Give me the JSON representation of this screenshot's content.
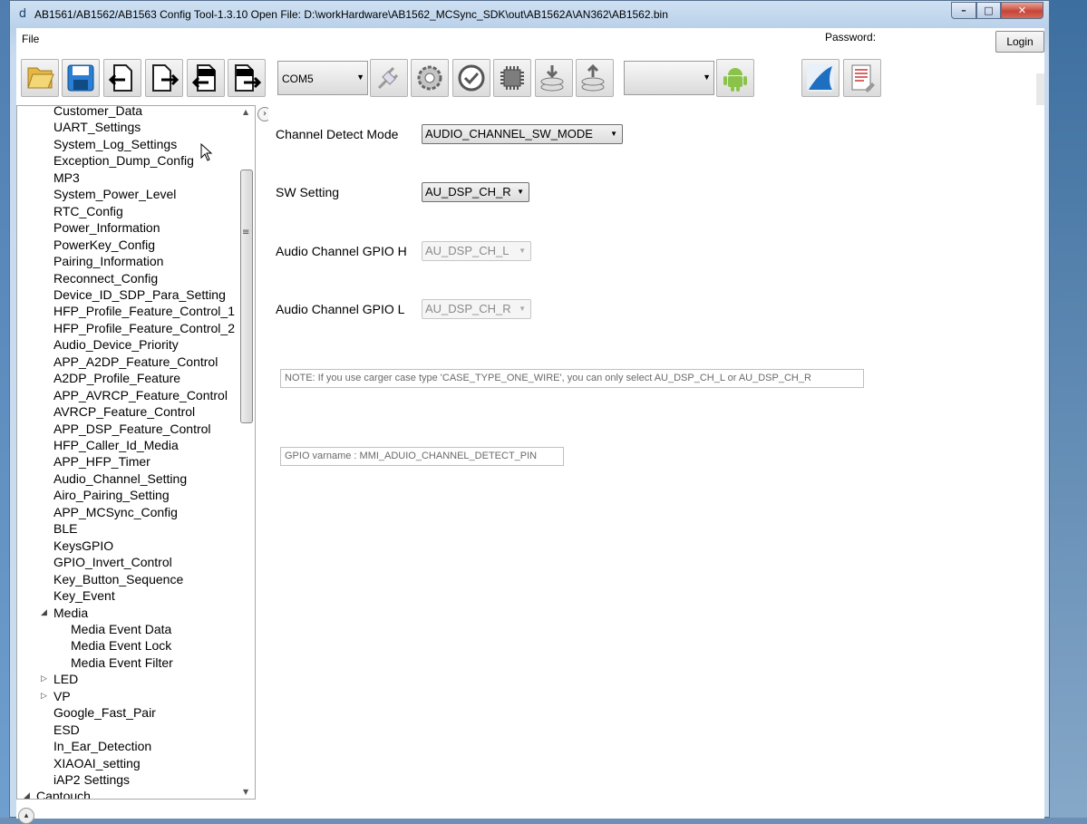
{
  "window": {
    "title": "AB1561/AB1562/AB1563 Config Tool-1.3.10   Open File: D:\\workHardware\\AB1562_MCSync_SDK\\out\\AB1562A\\AN362\\AB1562.bin",
    "minimize": "–",
    "maximize": "□",
    "close": "✕"
  },
  "menu": {
    "file": "File",
    "password_label": "Password:",
    "login": "Login"
  },
  "toolbar": {
    "com_port": "COM5",
    "second_combo": "",
    "icons": [
      "folder-open-icon",
      "save-icon",
      "import-icon",
      "export-icon",
      "rofs-import-icon",
      "rofs-export-icon",
      "connect-plug-icon",
      "settings-gear-icon",
      "check-clock-icon",
      "chip-icon",
      "download-disk-icon",
      "upload-disk-icon",
      "android-icon",
      "wireshark-fin-icon",
      "log-document-icon"
    ]
  },
  "tree": {
    "items": [
      {
        "label": "Customer_Data",
        "level": 1
      },
      {
        "label": "UART_Settings",
        "level": 1
      },
      {
        "label": "System_Log_Settings",
        "level": 1
      },
      {
        "label": "Exception_Dump_Config",
        "level": 1
      },
      {
        "label": "MP3",
        "level": 1
      },
      {
        "label": "System_Power_Level",
        "level": 1
      },
      {
        "label": "RTC_Config",
        "level": 1
      },
      {
        "label": "Power_Information",
        "level": 1
      },
      {
        "label": "PowerKey_Config",
        "level": 1
      },
      {
        "label": "Pairing_Information",
        "level": 1
      },
      {
        "label": "Reconnect_Config",
        "level": 1
      },
      {
        "label": "Device_ID_SDP_Para_Setting",
        "level": 1
      },
      {
        "label": "HFP_Profile_Feature_Control_1",
        "level": 1
      },
      {
        "label": "HFP_Profile_Feature_Control_2",
        "level": 1
      },
      {
        "label": "Audio_Device_Priority",
        "level": 1
      },
      {
        "label": "APP_A2DP_Feature_Control",
        "level": 1
      },
      {
        "label": "A2DP_Profile_Feature",
        "level": 1
      },
      {
        "label": "APP_AVRCP_Feature_Control",
        "level": 1
      },
      {
        "label": "AVRCP_Feature_Control",
        "level": 1
      },
      {
        "label": "APP_DSP_Feature_Control",
        "level": 1
      },
      {
        "label": "HFP_Caller_Id_Media",
        "level": 1
      },
      {
        "label": "APP_HFP_Timer",
        "level": 1
      },
      {
        "label": "Audio_Channel_Setting",
        "level": 1
      },
      {
        "label": "Airo_Pairing_Setting",
        "level": 1
      },
      {
        "label": "APP_MCSync_Config",
        "level": 1
      },
      {
        "label": "BLE",
        "level": 1
      },
      {
        "label": "KeysGPIO",
        "level": 1
      },
      {
        "label": "GPIO_Invert_Control",
        "level": 1
      },
      {
        "label": "Key_Button_Sequence",
        "level": 1
      },
      {
        "label": "Key_Event",
        "level": 1
      },
      {
        "label": "Media",
        "level": 1,
        "arrow": "expanded"
      },
      {
        "label": "Media Event Data",
        "level": 2
      },
      {
        "label": "Media Event Lock",
        "level": 2
      },
      {
        "label": "Media Event Filter",
        "level": 2
      },
      {
        "label": "LED",
        "level": 1,
        "arrow": "collapsed"
      },
      {
        "label": "VP",
        "level": 1,
        "arrow": "collapsed"
      },
      {
        "label": "Google_Fast_Pair",
        "level": 1
      },
      {
        "label": "ESD",
        "level": 1
      },
      {
        "label": "In_Ear_Detection",
        "level": 1
      },
      {
        "label": "XIAOAI_setting",
        "level": 1
      },
      {
        "label": "iAP2 Settings",
        "level": 1
      },
      {
        "label": "Captouch",
        "level": 0,
        "arrow": "expanded"
      }
    ]
  },
  "form": {
    "channel_detect_mode": {
      "label": "Channel Detect Mode",
      "value": "AUDIO_CHANNEL_SW_MODE"
    },
    "sw_setting": {
      "label": "SW Setting",
      "value": "AU_DSP_CH_R"
    },
    "gpio_h": {
      "label": "Audio Channel GPIO H",
      "value": "AU_DSP_CH_L"
    },
    "gpio_l": {
      "label": "Audio Channel GPIO L",
      "value": "AU_DSP_CH_R"
    },
    "note": "NOTE: If you use carger case type 'CASE_TYPE_ONE_WIRE', you can only select AU_DSP_CH_L or AU_DSP_CH_R",
    "gpio_varname": "GPIO varname : MMI_ADUIO_CHANNEL_DETECT_PIN"
  }
}
